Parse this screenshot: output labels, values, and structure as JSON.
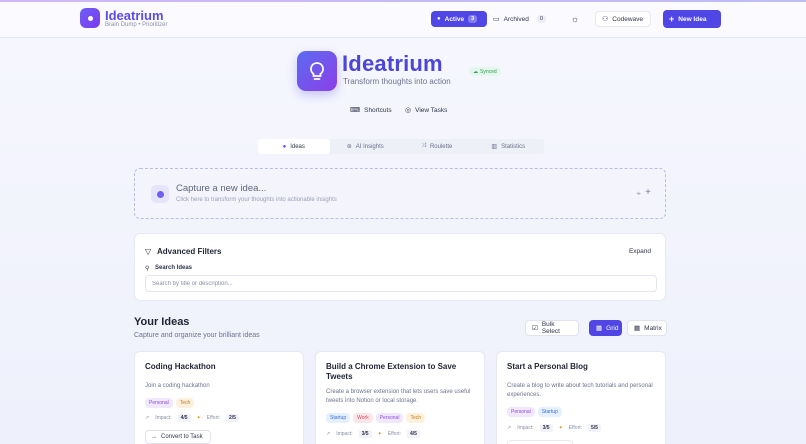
{
  "app": {
    "name": "Ideatrium",
    "subtitle": "Brain Dump • Prioritizer"
  },
  "header": {
    "active_label": "Active",
    "active_count": "3",
    "archived_label": "Archived",
    "archived_count": "0",
    "user_name": "Codewave",
    "new_idea_label": "New Idea"
  },
  "hero": {
    "title": "Ideatrium",
    "subtitle": "Transform thoughts into action",
    "synced_label": "Synced",
    "shortcuts_label": "Shortcuts",
    "view_tasks_label": "View Tasks"
  },
  "tabs": [
    {
      "label": "Ideas",
      "icon": "bulb-icon"
    },
    {
      "label": "AI Insights",
      "icon": "brain-icon"
    },
    {
      "label": "Roulette",
      "icon": "shuffle-icon"
    },
    {
      "label": "Statistics",
      "icon": "chart-icon"
    }
  ],
  "capture": {
    "title": "Capture a new idea...",
    "subtitle": "Click here to transform your thoughts into actionable insights"
  },
  "filters": {
    "title": "Advanced Filters",
    "expand_label": "Expand",
    "search_label": "Search Ideas",
    "search_placeholder": "Search by title or description..."
  },
  "ideas_section": {
    "title": "Your Ideas",
    "subtitle": "Capture and organize your brilliant ideas",
    "bulk_select_label": "Bulk Select",
    "grid_label": "Grid",
    "matrix_label": "Matrix"
  },
  "cards": [
    {
      "title": "Coding Hackathon",
      "description": "Join a coding hackathon",
      "tags": [
        "Personal",
        "Tech"
      ],
      "impact_label": "Impact:",
      "impact": "4/5",
      "effort_label": "Effort:",
      "effort": "2/5",
      "action_label": "Convert to Task"
    },
    {
      "title": "Build a Chrome Extension to Save Tweets",
      "description": "Create a browser extension that lets users save useful tweets into Notion or local storage.",
      "tags": [
        "Startup",
        "Work",
        "Personal",
        "Tech"
      ],
      "impact_label": "Impact:",
      "impact": "3/5",
      "effort_label": "Effort:",
      "effort": "4/5"
    },
    {
      "title": "Start a Personal Blog",
      "description": "Create a blog to write about tech tutorials and personal experiences.",
      "tags": [
        "Personal",
        "Startup"
      ],
      "impact_label": "Impact:",
      "impact": "3/5",
      "effort_label": "Effort:",
      "effort": "5/5"
    }
  ],
  "colors": {
    "accent": "#4f46e5",
    "brand_gradient_end": "#7c3aed",
    "synced": "#2f9a5a"
  }
}
